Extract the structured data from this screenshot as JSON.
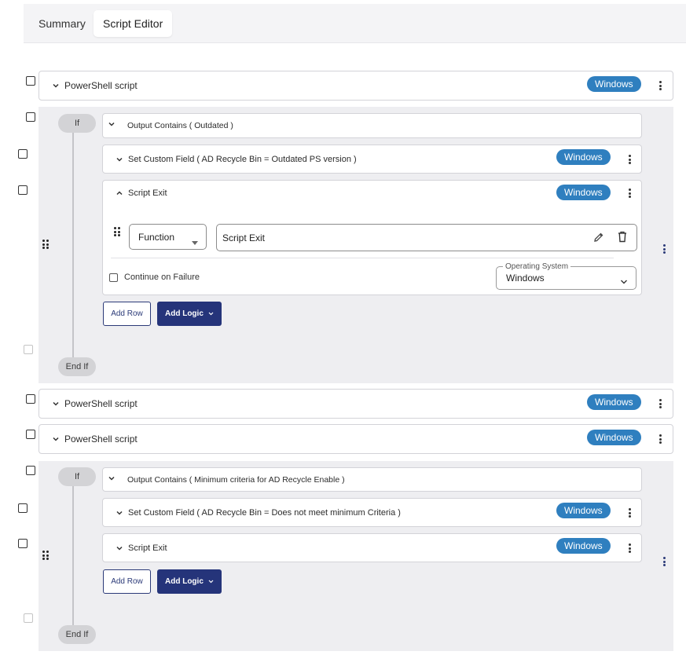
{
  "tabs": [
    {
      "label": "Summary",
      "active": false
    },
    {
      "label": "Script Editor",
      "active": true
    }
  ],
  "colors": {
    "badge": "#2f7fbf",
    "primary_button": "#25347a",
    "block_bg": "#eeeef1"
  },
  "steps": {
    "ps1": {
      "label": "PowerShell script",
      "badge": "Windows"
    },
    "ps2": {
      "label": "PowerShell script",
      "badge": "Windows"
    },
    "ps3": {
      "label": "PowerShell script",
      "badge": "Windows"
    }
  },
  "if1": {
    "if_label": "If",
    "endif_label": "End If",
    "condition": "Output Contains ( Outdated )",
    "set_field": {
      "label": "Set Custom Field ( AD Recycle Bin = Outdated PS version )",
      "badge": "Windows"
    },
    "script_exit": {
      "label": "Script Exit",
      "badge": "Windows",
      "type_select": "Function",
      "function_value": "Script Exit",
      "continue_label": "Continue on Failure",
      "os_label": "Operating System",
      "os_value": "Windows"
    },
    "add_row": "Add Row",
    "add_logic": "Add Logic"
  },
  "if2": {
    "if_label": "If",
    "endif_label": "End If",
    "condition": "Output Contains ( Minimum criteria for AD Recycle Enable )",
    "set_field": {
      "label": "Set Custom Field ( AD Recycle Bin = Does not meet minimum Criteria )",
      "badge": "Windows"
    },
    "script_exit": {
      "label": "Script Exit",
      "badge": "Windows"
    },
    "add_row": "Add Row",
    "add_logic": "Add Logic"
  }
}
